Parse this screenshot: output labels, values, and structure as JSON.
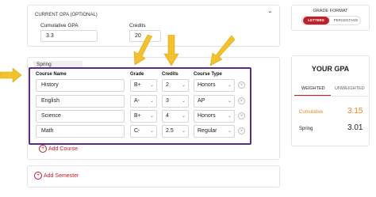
{
  "current_gpa": {
    "title": "CURRENT GPA (OPTIONAL)",
    "cumulative_label": "Cumulative GPA",
    "cumulative_value": "3.3",
    "credits_label": "Credits",
    "credits_value": "20",
    "collapse_icon": "chevron-up-icon"
  },
  "semester": {
    "name": "Spring",
    "headers": {
      "course": "Course Name",
      "grade": "Grade",
      "credits": "Credits",
      "type": "Course Type"
    },
    "courses": [
      {
        "name": "History",
        "grade": "B+",
        "credits": "2",
        "type": "Honors"
      },
      {
        "name": "English",
        "grade": "A-",
        "credits": "3",
        "type": "AP"
      },
      {
        "name": "Science",
        "grade": "B+",
        "credits": "4",
        "type": "Honors"
      },
      {
        "name": "Math",
        "grade": "C-",
        "credits": "2.5",
        "type": "Regular"
      }
    ],
    "add_course": "Add Course"
  },
  "add_semester": "Add Semester",
  "grade_format": {
    "title": "GRADE FORMAT",
    "option_active": "LETTERS",
    "option_inactive": "PERCENTAGE"
  },
  "your_gpa": {
    "title": "YOUR GPA",
    "tab_weighted": "WEIGHTED",
    "tab_unweighted": "UNWEIGHTED",
    "rows": [
      {
        "label": "Cumulative",
        "value": "3.15"
      },
      {
        "label": "Spring",
        "value": "3.01"
      }
    ]
  },
  "colors": {
    "accent": "#c0202a",
    "highlight_border": "#5b2a86",
    "arrow": "#f2c12e",
    "cumulative_orange": "#e8841c"
  }
}
